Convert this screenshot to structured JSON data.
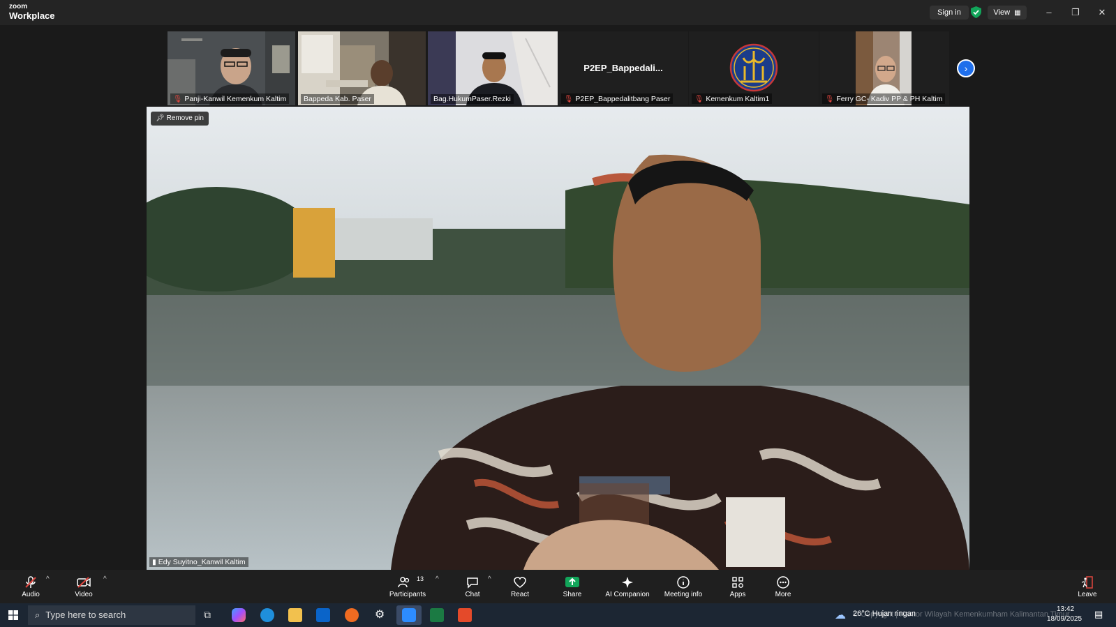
{
  "titlebar": {
    "brand_small": "zoom",
    "brand_large": "Workplace",
    "signin_label": "Sign in",
    "view_label": "View"
  },
  "gallery": [
    {
      "name": "Panji-Kanwil Kemenkum Kaltim",
      "muted": true
    },
    {
      "name": "Bappeda Kab. Paser",
      "muted": false
    },
    {
      "name": "Bag.HukumPaser.Rezki",
      "muted": false
    },
    {
      "name": "P2EP_Bappedalitbang Paser",
      "muted": true,
      "avatar_text": "P2EP_Bappedali..."
    },
    {
      "name": "Kemenkum Kaltim1",
      "muted": true
    },
    {
      "name": "Ferry GC- Kadiv PP & PH Kaltim",
      "muted": true
    }
  ],
  "main_video": {
    "pin_label": "Remove pin",
    "speaker_name": "Edy Suyitno_Kanwil Kaltim"
  },
  "toolbar": {
    "audio": "Audio",
    "video": "Video",
    "participants": "Participants",
    "participants_count": "13",
    "chat": "Chat",
    "react": "React",
    "share": "Share",
    "ai": "AI Companion",
    "meeting_info": "Meeting info",
    "apps": "Apps",
    "more": "More",
    "leave": "Leave"
  },
  "taskbar": {
    "search_placeholder": "Type here to search",
    "weather": "26°C  Hujan ringan",
    "time": "13:42",
    "date": "18/09/2025",
    "watermark": "© Copyright | Kantor Wilayah Kemenkumham Kalimantan Timur"
  },
  "colors": {
    "accent": "#1f6feb",
    "mute": "#e0463f",
    "share": "#12a55a"
  }
}
